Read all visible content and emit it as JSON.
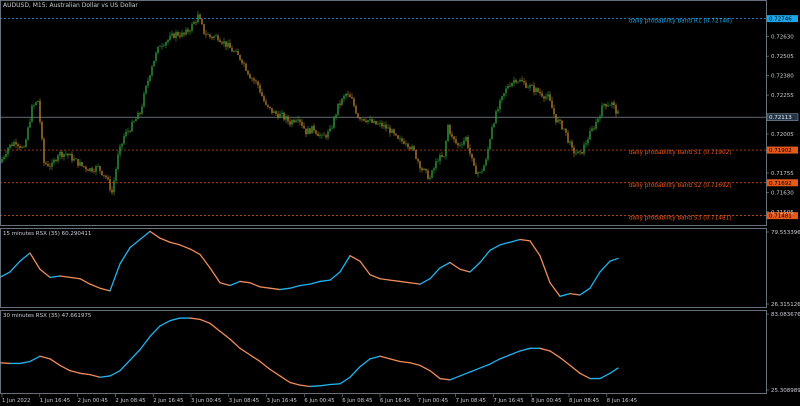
{
  "window": {
    "title": "AUDUSD, M15:  Australian Dollar vs US Dollar"
  },
  "colors": {
    "background": "#000000",
    "grid": "#243447",
    "axis": "#7f8c99",
    "text": "#c8ccd0",
    "candle_bull": "#2e9b3a",
    "candle_bear": "#b07a2a",
    "band_r": "#1aa6e8",
    "band_s": "#e8581a",
    "current_price": "#9aa8b6",
    "rsx_up": "#1fb3f0",
    "rsx_down": "#f08c5a"
  },
  "bands": [
    {
      "label": "daily probability band R1 (0.72746)",
      "value": 0.72746,
      "axis_label": "0.72746",
      "kind": "R"
    },
    {
      "label": "daily probability band S1 (0.71902)",
      "value": 0.71902,
      "axis_label": "0.71902",
      "kind": "S"
    },
    {
      "label": "daily probability band S2 (0.71692)",
      "value": 0.71692,
      "axis_label": "0.71692",
      "kind": "S"
    },
    {
      "label": "daily probability band S3 (0.71481)",
      "value": 0.71481,
      "axis_label": "0.71481",
      "kind": "S"
    }
  ],
  "current_price": {
    "value": 0.72113,
    "label": "0.72113"
  },
  "chart_data": [
    {
      "type": "candlestick",
      "title": "AUDUSD, M15:  Australian Dollar vs US Dollar",
      "ylim": [
        0.7144,
        0.7284
      ],
      "y_ticks": [
        "0.72630",
        "0.72505",
        "0.72380",
        "0.72255",
        "0.72005",
        "0.71755",
        "0.71630",
        "0.71505"
      ],
      "series": [
        {
          "name": "AUDUSD",
          "x": [
            0,
            8,
            16,
            24,
            32,
            38,
            44,
            52,
            58,
            66,
            74,
            82,
            90,
            98,
            106,
            112,
            118,
            124,
            132,
            140,
            146,
            152,
            160,
            168,
            176,
            184,
            192,
            198,
            204,
            210,
            218,
            226,
            234,
            242,
            250,
            258,
            266,
            274,
            282,
            290,
            298,
            306,
            314,
            322,
            330,
            338,
            346,
            352,
            358,
            366,
            374,
            382,
            390,
            398,
            406,
            414,
            422,
            430,
            438,
            444,
            448,
            452,
            458,
            466,
            474,
            480,
            486,
            492,
            500,
            508,
            516,
            524,
            532,
            540,
            548,
            556,
            564,
            572,
            580,
            588,
            596,
            604,
            612,
            618
          ],
          "values": [
            0.7182,
            0.7192,
            0.7196,
            0.719,
            0.7217,
            0.7222,
            0.7182,
            0.718,
            0.7188,
            0.7188,
            0.7184,
            0.718,
            0.7178,
            0.7179,
            0.7173,
            0.7163,
            0.7186,
            0.7199,
            0.7206,
            0.7214,
            0.723,
            0.7245,
            0.7258,
            0.7261,
            0.7265,
            0.7264,
            0.727,
            0.7276,
            0.7266,
            0.7263,
            0.7263,
            0.7258,
            0.7253,
            0.7248,
            0.7238,
            0.7232,
            0.7218,
            0.7214,
            0.7212,
            0.7208,
            0.7212,
            0.7202,
            0.7204,
            0.7198,
            0.7202,
            0.7218,
            0.7226,
            0.7222,
            0.7212,
            0.721,
            0.7207,
            0.7206,
            0.7203,
            0.7196,
            0.7196,
            0.7189,
            0.7178,
            0.7172,
            0.7185,
            0.7185,
            0.7206,
            0.7198,
            0.7193,
            0.7198,
            0.7178,
            0.7175,
            0.7183,
            0.7206,
            0.722,
            0.7232,
            0.7236,
            0.7233,
            0.723,
            0.7227,
            0.7224,
            0.721,
            0.7204,
            0.719,
            0.7187,
            0.7198,
            0.7208,
            0.722,
            0.722,
            0.7213
          ]
        }
      ]
    },
    {
      "type": "line",
      "title": "15 minutes RSX (35) 60.290411",
      "ylim": [
        26.315126,
        79.553396
      ],
      "y_ticks": [
        "79.553396",
        "26.315126"
      ],
      "series": [
        {
          "name": "RSX (35)",
          "x": [
            0,
            10,
            20,
            30,
            40,
            50,
            60,
            70,
            80,
            90,
            100,
            110,
            120,
            130,
            140,
            150,
            160,
            170,
            180,
            190,
            200,
            210,
            220,
            230,
            240,
            250,
            260,
            270,
            280,
            290,
            300,
            310,
            320,
            330,
            340,
            350,
            360,
            370,
            380,
            390,
            400,
            410,
            420,
            430,
            440,
            450,
            460,
            470,
            480,
            490,
            500,
            510,
            520,
            530,
            540,
            550,
            560,
            570,
            580,
            590,
            600,
            610,
            618
          ],
          "values": [
            46,
            50,
            58,
            64,
            52,
            46,
            47,
            46,
            45,
            41,
            38,
            36,
            56,
            68,
            74,
            80,
            75,
            72,
            70,
            67,
            63,
            53,
            42,
            40,
            43,
            42,
            39,
            38,
            37,
            38,
            40,
            41,
            43,
            44,
            50,
            62,
            58,
            48,
            45,
            44,
            43,
            42,
            41,
            45,
            53,
            57,
            52,
            50,
            57,
            66,
            70,
            72,
            74,
            73,
            62,
            42,
            32,
            34,
            33,
            38,
            50,
            58,
            60
          ]
        }
      ]
    },
    {
      "type": "line",
      "title": "30 minutes RSX (35) 47.661975",
      "ylim": [
        25.308989,
        83.083676
      ],
      "y_ticks": [
        "83.083676",
        "25.308989"
      ],
      "series": [
        {
          "name": "RSX (35)",
          "x": [
            0,
            10,
            20,
            30,
            40,
            50,
            60,
            70,
            80,
            90,
            100,
            110,
            120,
            130,
            140,
            150,
            160,
            170,
            180,
            190,
            200,
            210,
            220,
            230,
            240,
            250,
            260,
            270,
            280,
            290,
            300,
            310,
            320,
            330,
            340,
            350,
            360,
            370,
            380,
            390,
            400,
            410,
            420,
            430,
            440,
            450,
            460,
            470,
            480,
            490,
            500,
            510,
            520,
            530,
            540,
            550,
            560,
            570,
            580,
            590,
            600,
            610,
            618
          ],
          "values": [
            46,
            45.5,
            45.5,
            47,
            51,
            49,
            44,
            40,
            38,
            37,
            35,
            36,
            40,
            48,
            56,
            66,
            74,
            78,
            80,
            80,
            79,
            76,
            70,
            64,
            57,
            52,
            47,
            41,
            36,
            31,
            29,
            28,
            28.5,
            29.5,
            30,
            35,
            43,
            49,
            51,
            49,
            47,
            46,
            44,
            40,
            34,
            33,
            36,
            39,
            42,
            45,
            49,
            52,
            55,
            57,
            57,
            55,
            50,
            44,
            38,
            34,
            34,
            38,
            42
          ]
        }
      ]
    }
  ],
  "x_axis_labels": [
    "1 Jun 2022",
    "1 Jun 16:45",
    "2 Jun 00:45",
    "2 Jun 08:45",
    "2 Jun 16:45",
    "3 Jun 00:45",
    "3 Jun 08:45",
    "3 Jun 16:45",
    "6 Jun 00:45",
    "6 Jun 08:45",
    "6 Jun 16:45",
    "7 Jun 00:45",
    "7 Jun 08:45",
    "7 Jun 16:45",
    "8 Jun 00:45",
    "8 Jun 08:45",
    "8 Jun 16:45"
  ]
}
